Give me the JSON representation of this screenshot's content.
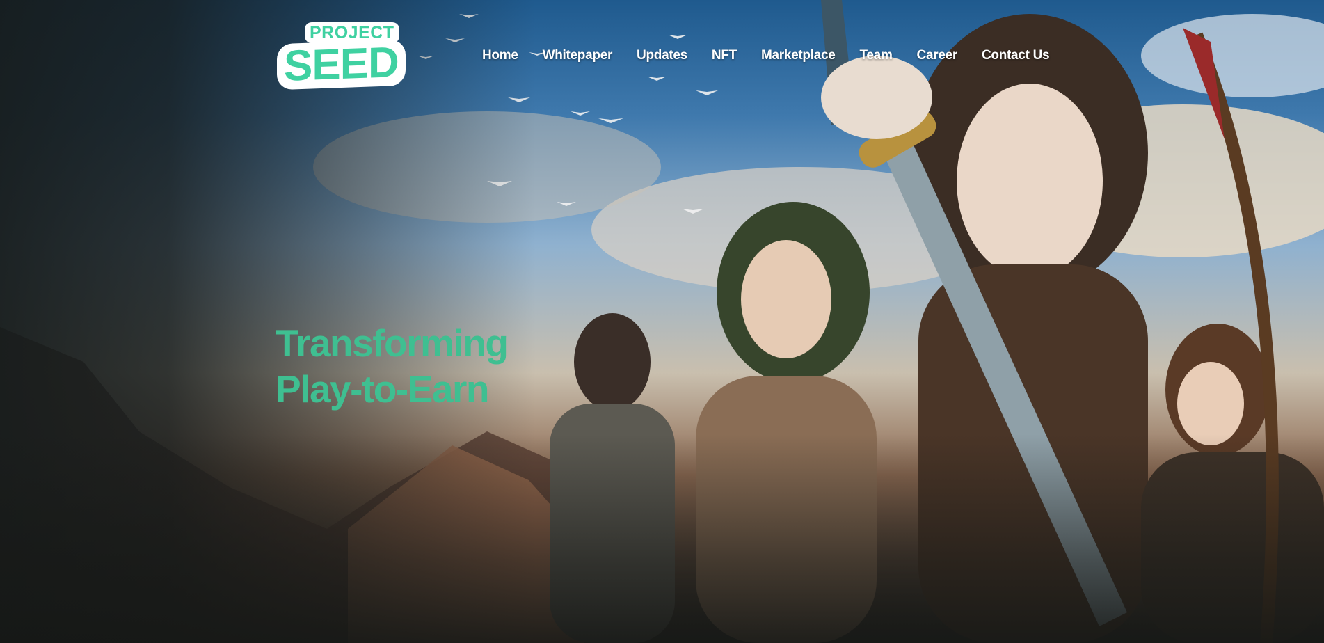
{
  "brand": {
    "logo_top": "PROJECT",
    "logo_main": "SEED",
    "accent_color": "#3fd1a1"
  },
  "nav": {
    "items": [
      {
        "label": "Home"
      },
      {
        "label": "Whitepaper"
      },
      {
        "label": "Updates"
      },
      {
        "label": "NFT"
      },
      {
        "label": "Marketplace"
      },
      {
        "label": "Team"
      },
      {
        "label": "Career"
      },
      {
        "label": "Contact Us"
      }
    ]
  },
  "hero": {
    "headline_line1": "Transforming",
    "headline_line2": "Play-to-Earn",
    "headline_color": "#3fbf91",
    "artwork": "fantasy-characters-illustration"
  }
}
